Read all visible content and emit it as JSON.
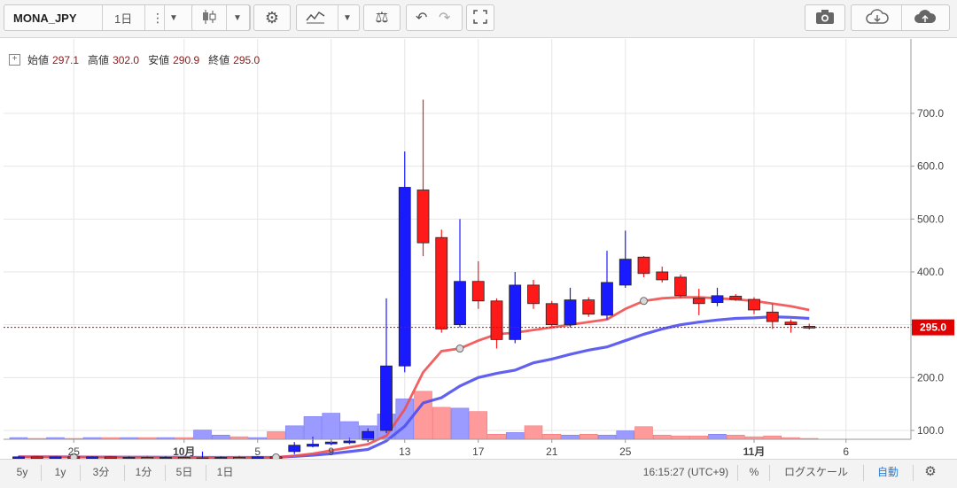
{
  "toolbar": {
    "symbol": "MONA_JPY",
    "interval": "1日",
    "icons": [
      "more-vert-icon",
      "dropdown-icon",
      "candlestick-icon",
      "dropdown-icon",
      "settings-icon",
      "indicators-icon",
      "dropdown-icon",
      "compare-icon",
      "undo-icon",
      "redo-icon",
      "fullscreen-icon",
      "camera-icon",
      "cloud-download-icon",
      "cloud-upload-icon"
    ]
  },
  "ohlc": {
    "open_label": "始値",
    "open": "297.1",
    "high_label": "高値",
    "high": "302.0",
    "low_label": "安値",
    "low": "290.9",
    "close_label": "終値",
    "close": "295.0"
  },
  "bottom": {
    "ranges": [
      "5y",
      "1y",
      "3分",
      "1分",
      "5日",
      "1日"
    ],
    "time": "16:15:27 (UTC+9)",
    "percent": "%",
    "log": "ログスケール",
    "auto": "自動",
    "gear": "gear-icon"
  },
  "colors": {
    "up": "#1a1aff",
    "down": "#ff1a1a",
    "ma_fast": "#f05050",
    "ma_slow": "#5050f0",
    "last": "#e00000"
  },
  "chart_data": {
    "type": "candlestick",
    "ylim": [
      0,
      750
    ],
    "yticks": [
      "100.0",
      "200.0",
      "300.0",
      "400.0",
      "500.0",
      "600.0",
      "700.0"
    ],
    "xtick_labels": [
      {
        "i": 3,
        "label": "25"
      },
      {
        "i": 9,
        "label": "10月"
      },
      {
        "i": 13,
        "label": "5"
      },
      {
        "i": 17,
        "label": "9"
      },
      {
        "i": 21,
        "label": "13"
      },
      {
        "i": 25,
        "label": "17"
      },
      {
        "i": 29,
        "label": "21"
      },
      {
        "i": 33,
        "label": "25"
      },
      {
        "i": 40,
        "label": "11月"
      },
      {
        "i": 45,
        "label": "6"
      }
    ],
    "last_price": "295.0",
    "candles": [
      {
        "o": 50,
        "h": 52,
        "l": 48,
        "c": 50
      },
      {
        "o": 50,
        "h": 52,
        "l": 48,
        "c": 49
      },
      {
        "o": 49,
        "h": 51,
        "l": 47,
        "c": 50
      },
      {
        "o": 50,
        "h": 52,
        "l": 48,
        "c": 49
      },
      {
        "o": 49,
        "h": 51,
        "l": 47,
        "c": 50
      },
      {
        "o": 50,
        "h": 52,
        "l": 47,
        "c": 48
      },
      {
        "o": 48,
        "h": 51,
        "l": 46,
        "c": 49
      },
      {
        "o": 49,
        "h": 52,
        "l": 47,
        "c": 48
      },
      {
        "o": 48,
        "h": 51,
        "l": 46,
        "c": 49
      },
      {
        "o": 49,
        "h": 52,
        "l": 47,
        "c": 48
      },
      {
        "o": 48,
        "h": 60,
        "l": 46,
        "c": 48
      },
      {
        "o": 48,
        "h": 51,
        "l": 46,
        "c": 49
      },
      {
        "o": 49,
        "h": 52,
        "l": 47,
        "c": 48
      },
      {
        "o": 48,
        "h": 51,
        "l": 47,
        "c": 50
      },
      {
        "o": 50,
        "h": 53,
        "l": 47,
        "c": 49
      },
      {
        "o": 60,
        "h": 78,
        "l": 55,
        "c": 72
      },
      {
        "o": 70,
        "h": 88,
        "l": 68,
        "c": 74
      },
      {
        "o": 76,
        "h": 84,
        "l": 72,
        "c": 78
      },
      {
        "o": 78,
        "h": 86,
        "l": 74,
        "c": 80
      },
      {
        "o": 82,
        "h": 104,
        "l": 78,
        "c": 98
      },
      {
        "o": 100,
        "h": 350,
        "l": 95,
        "c": 222
      },
      {
        "o": 222,
        "h": 628,
        "l": 210,
        "c": 560
      },
      {
        "o": 555,
        "h": 726,
        "l": 430,
        "c": 455
      },
      {
        "o": 465,
        "h": 480,
        "l": 285,
        "c": 292
      },
      {
        "o": 300,
        "h": 500,
        "l": 295,
        "c": 382
      },
      {
        "o": 382,
        "h": 420,
        "l": 330,
        "c": 345
      },
      {
        "o": 345,
        "h": 350,
        "l": 255,
        "c": 272
      },
      {
        "o": 272,
        "h": 400,
        "l": 265,
        "c": 375
      },
      {
        "o": 375,
        "h": 385,
        "l": 330,
        "c": 340
      },
      {
        "o": 340,
        "h": 345,
        "l": 295,
        "c": 300
      },
      {
        "o": 300,
        "h": 370,
        "l": 295,
        "c": 347
      },
      {
        "o": 347,
        "h": 352,
        "l": 315,
        "c": 320
      },
      {
        "o": 318,
        "h": 440,
        "l": 310,
        "c": 380
      },
      {
        "o": 375,
        "h": 478,
        "l": 370,
        "c": 424
      },
      {
        "o": 428,
        "h": 430,
        "l": 390,
        "c": 397
      },
      {
        "o": 400,
        "h": 410,
        "l": 380,
        "c": 385
      },
      {
        "o": 390,
        "h": 395,
        "l": 350,
        "c": 355
      },
      {
        "o": 350,
        "h": 368,
        "l": 318,
        "c": 340
      },
      {
        "o": 342,
        "h": 370,
        "l": 335,
        "c": 355
      },
      {
        "o": 354,
        "h": 358,
        "l": 345,
        "c": 348
      },
      {
        "o": 348,
        "h": 352,
        "l": 320,
        "c": 328
      },
      {
        "o": 324,
        "h": 340,
        "l": 292,
        "c": 306
      },
      {
        "o": 305,
        "h": 310,
        "l": 285,
        "c": 300
      },
      {
        "o": 297.1,
        "h": 302.0,
        "l": 290.9,
        "c": 295.0
      }
    ],
    "volume": [
      2,
      1,
      2,
      1,
      2,
      2,
      2,
      2,
      2,
      2,
      11,
      5,
      3,
      2,
      9,
      16,
      27,
      31,
      21,
      16,
      30,
      48,
      57,
      38,
      37,
      33,
      6,
      8,
      16,
      6,
      5,
      6,
      5,
      10,
      15,
      5,
      4,
      4,
      6,
      5,
      3,
      4,
      2,
      1
    ],
    "ma_fast": [
      50,
      50,
      49.8,
      49.7,
      49.6,
      49.5,
      49.4,
      49.3,
      49.2,
      49.1,
      49,
      49,
      49,
      49,
      49,
      52,
      56,
      62,
      68,
      74,
      90,
      140,
      210,
      250,
      255,
      270,
      282,
      285,
      290,
      295,
      300,
      305,
      310,
      330,
      345,
      350,
      352,
      352,
      350,
      348,
      345,
      340,
      335,
      328
    ],
    "ma_slow": [
      50,
      50,
      50,
      49.8,
      49.6,
      49.5,
      49.4,
      49.3,
      49.2,
      49.1,
      49,
      49,
      49,
      49,
      49,
      51,
      53,
      56,
      60,
      64,
      80,
      108,
      152,
      162,
      184,
      200,
      208,
      214,
      228,
      235,
      244,
      252,
      258,
      270,
      282,
      292,
      300,
      305,
      309,
      312,
      313,
      315,
      314,
      312
    ],
    "ma_markers": [
      {
        "series": "ma_fast",
        "i": 3
      },
      {
        "series": "ma_fast",
        "i": 14
      },
      {
        "series": "ma_fast",
        "i": 24
      },
      {
        "series": "ma_fast",
        "i": 34
      }
    ]
  }
}
